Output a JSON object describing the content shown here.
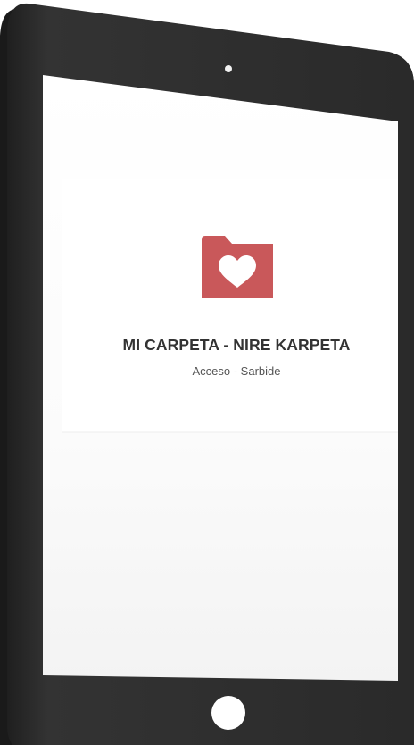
{
  "app": {
    "title": "MI CARPETA - NIRE KARPETA",
    "subtitle": "Acceso - Sarbide"
  },
  "icons": {
    "logo": "folder-heart-icon",
    "home_button": "home-button",
    "camera": "camera-icon"
  },
  "colors": {
    "folder": "#c9585a",
    "device_body": "#2b2b2b",
    "title_text": "#333333",
    "subtitle_text": "#555555"
  }
}
